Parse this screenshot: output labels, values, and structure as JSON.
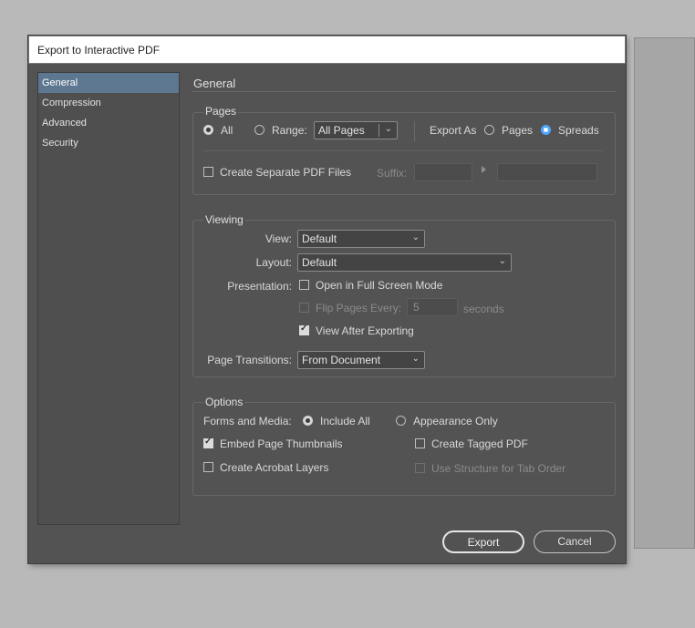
{
  "dialog": {
    "title": "Export to Interactive PDF"
  },
  "sidebar": {
    "items": [
      {
        "label": "General"
      },
      {
        "label": "Compression"
      },
      {
        "label": "Advanced"
      },
      {
        "label": "Security"
      }
    ]
  },
  "section_title": "General",
  "pages": {
    "group_label": "Pages",
    "all_label": "All",
    "range_label": "Range:",
    "range_value": "All Pages",
    "export_as_label": "Export As",
    "pages_label": "Pages",
    "spreads_label": "Spreads",
    "separate_label": "Create Separate PDF Files",
    "suffix_label": "Suffix:"
  },
  "viewing": {
    "group_label": "Viewing",
    "view_label": "View:",
    "view_value": "Default",
    "layout_label": "Layout:",
    "layout_value": "Default",
    "presentation_label": "Presentation:",
    "fullscreen_label": "Open in Full Screen Mode",
    "flip_label": "Flip Pages Every:",
    "flip_value": "5",
    "seconds_label": "seconds",
    "view_after_label": "View After Exporting",
    "transitions_label": "Page Transitions:",
    "transitions_value": "From Document"
  },
  "options": {
    "group_label": "Options",
    "forms_label": "Forms and Media:",
    "include_all_label": "Include All",
    "appearance_only_label": "Appearance Only",
    "thumbnails_label": "Embed Page Thumbnails",
    "tagged_label": "Create Tagged PDF",
    "layers_label": "Create Acrobat Layers",
    "tab_order_label": "Use Structure for Tab Order"
  },
  "buttons": {
    "export": "Export",
    "cancel": "Cancel"
  },
  "colors": {
    "dialog_bg": "#535353",
    "selected_sidebar": "#5e7790",
    "radio_accent": "#4da6ff",
    "desktop_bg": "#b9b9b9"
  },
  "icons": [
    "chevron-down-icon",
    "triangle-right-icon"
  ]
}
